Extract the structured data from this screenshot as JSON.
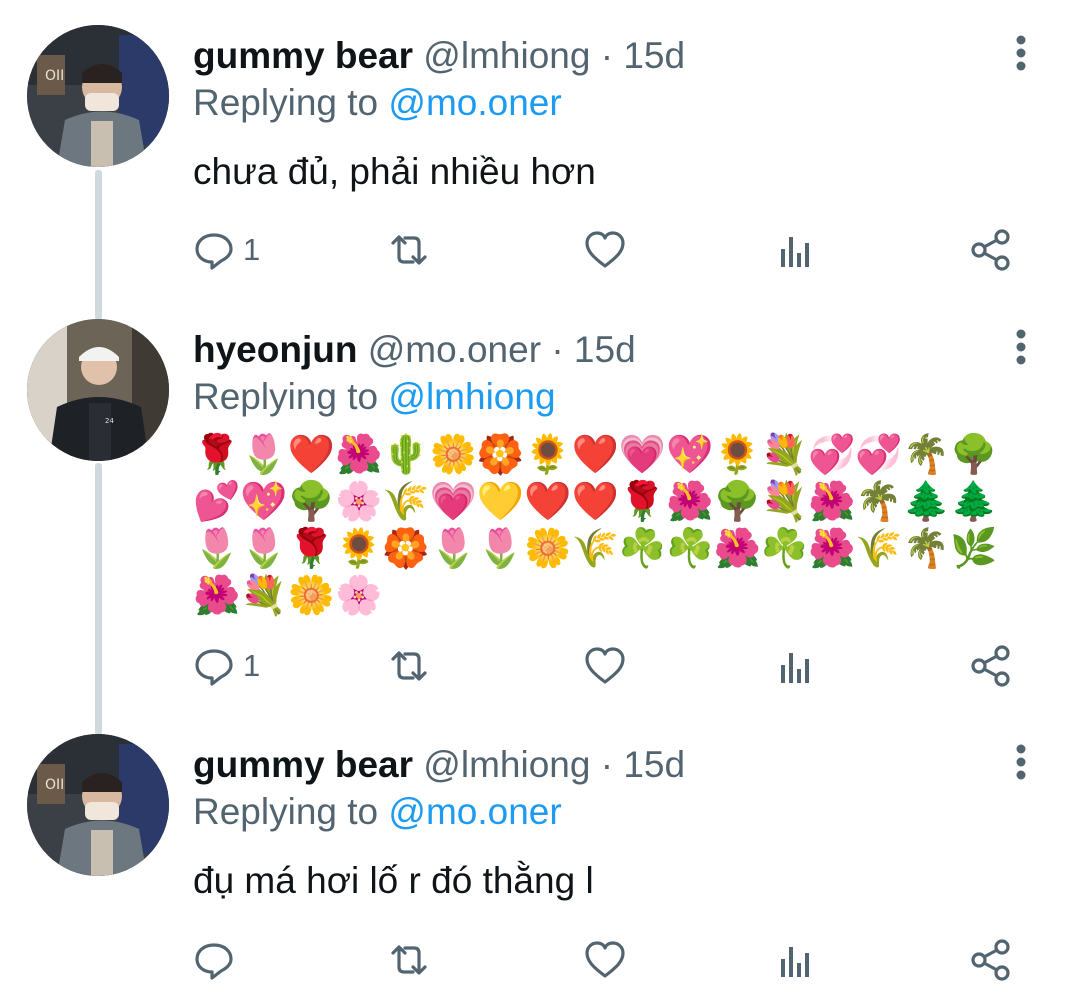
{
  "thread": {
    "tweets": [
      {
        "name": "gummy bear",
        "handle": "@lmhiong",
        "separator": "·",
        "time": "15d",
        "replying_prefix": "Replying to",
        "replying_to": "@mo.oner",
        "text": "chưa đủ, phải nhiều hơn",
        "reply_count": "1",
        "avatar_icon": "avatar-photo-masked-person",
        "actions": [
          "reply-icon",
          "retweet-icon",
          "like-icon",
          "analytics-icon",
          "share-icon"
        ]
      },
      {
        "name": "hyeonjun",
        "handle": "@mo.oner",
        "separator": "·",
        "time": "15d",
        "replying_prefix": "Replying to",
        "replying_to": "@lmhiong",
        "text": "🌹🌷❤️🌺🌵🌼🏵️🌻❤️💗💖🌻💐💞💞🌴🌳💕💖🌳🌸🌾💗💛❤️❤️🌹🌺🌳💐🌺🌴🌲🌲🌷🌷🌹🌻🏵️🌷🌷🌼🌾☘️☘️🌺☘️🌺🌾🌴🌿🌺💐🌼🌸",
        "reply_count": "1",
        "avatar_icon": "avatar-photo-person-in-cap",
        "actions": [
          "reply-icon",
          "retweet-icon",
          "like-icon",
          "analytics-icon",
          "share-icon"
        ]
      },
      {
        "name": "gummy bear",
        "handle": "@lmhiong",
        "separator": "·",
        "time": "15d",
        "replying_prefix": "Replying to",
        "replying_to": "@mo.oner",
        "text": "đụ má hơi lố r đó thằng l",
        "reply_count": "",
        "avatar_icon": "avatar-photo-masked-person",
        "actions": [
          "reply-icon",
          "retweet-icon",
          "like-icon",
          "analytics-icon",
          "share-icon"
        ]
      }
    ]
  },
  "colors": {
    "text_primary": "#0f1419",
    "text_secondary": "#536471",
    "mention": "#1d9bf0",
    "thread_line": "#cfd9de"
  }
}
